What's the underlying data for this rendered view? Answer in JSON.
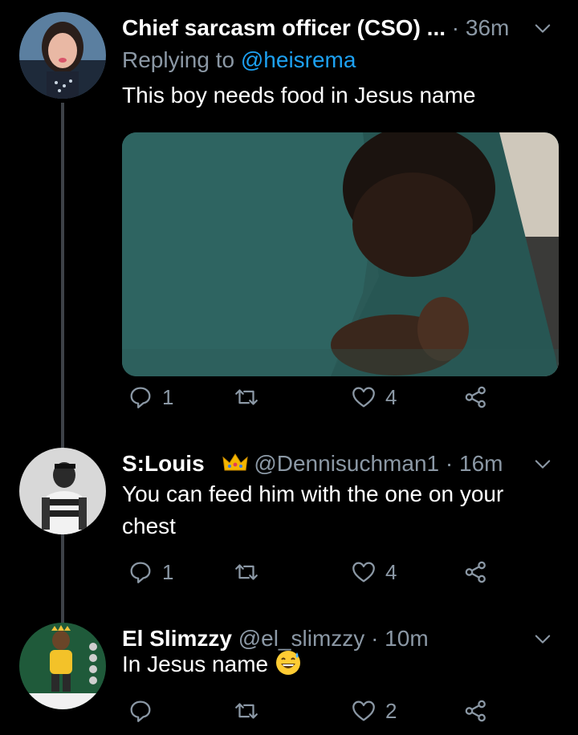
{
  "tweets": [
    {
      "name": "Chief sarcasm officer (CSO) ...",
      "time": "36m",
      "replying_prefix": "Replying to ",
      "replying_handle": "@heisrema",
      "text": "This boy needs food in Jesus name",
      "replies": "1",
      "likes": "4"
    },
    {
      "name": "S:Louis⠀",
      "handle": "@Dennisuchman1",
      "time": "16m",
      "text": "You can feed him with the one on your chest",
      "replies": "1",
      "likes": "4"
    },
    {
      "name": "El Slimzzy",
      "handle": "@el_slimzzy",
      "time": "10m",
      "text": "In Jesus name",
      "replies": "",
      "likes": "2"
    }
  ],
  "separator": "·",
  "icons": [
    "reply-icon",
    "retweet-icon",
    "like-icon",
    "share-icon",
    "chevron-down-icon",
    "crown-emoji",
    "grin-sweat-emoji"
  ],
  "colors": {
    "background": "#000000",
    "secondary_text": "#8b98a5",
    "link": "#1da1f2",
    "thread_line": "#3d4147"
  }
}
